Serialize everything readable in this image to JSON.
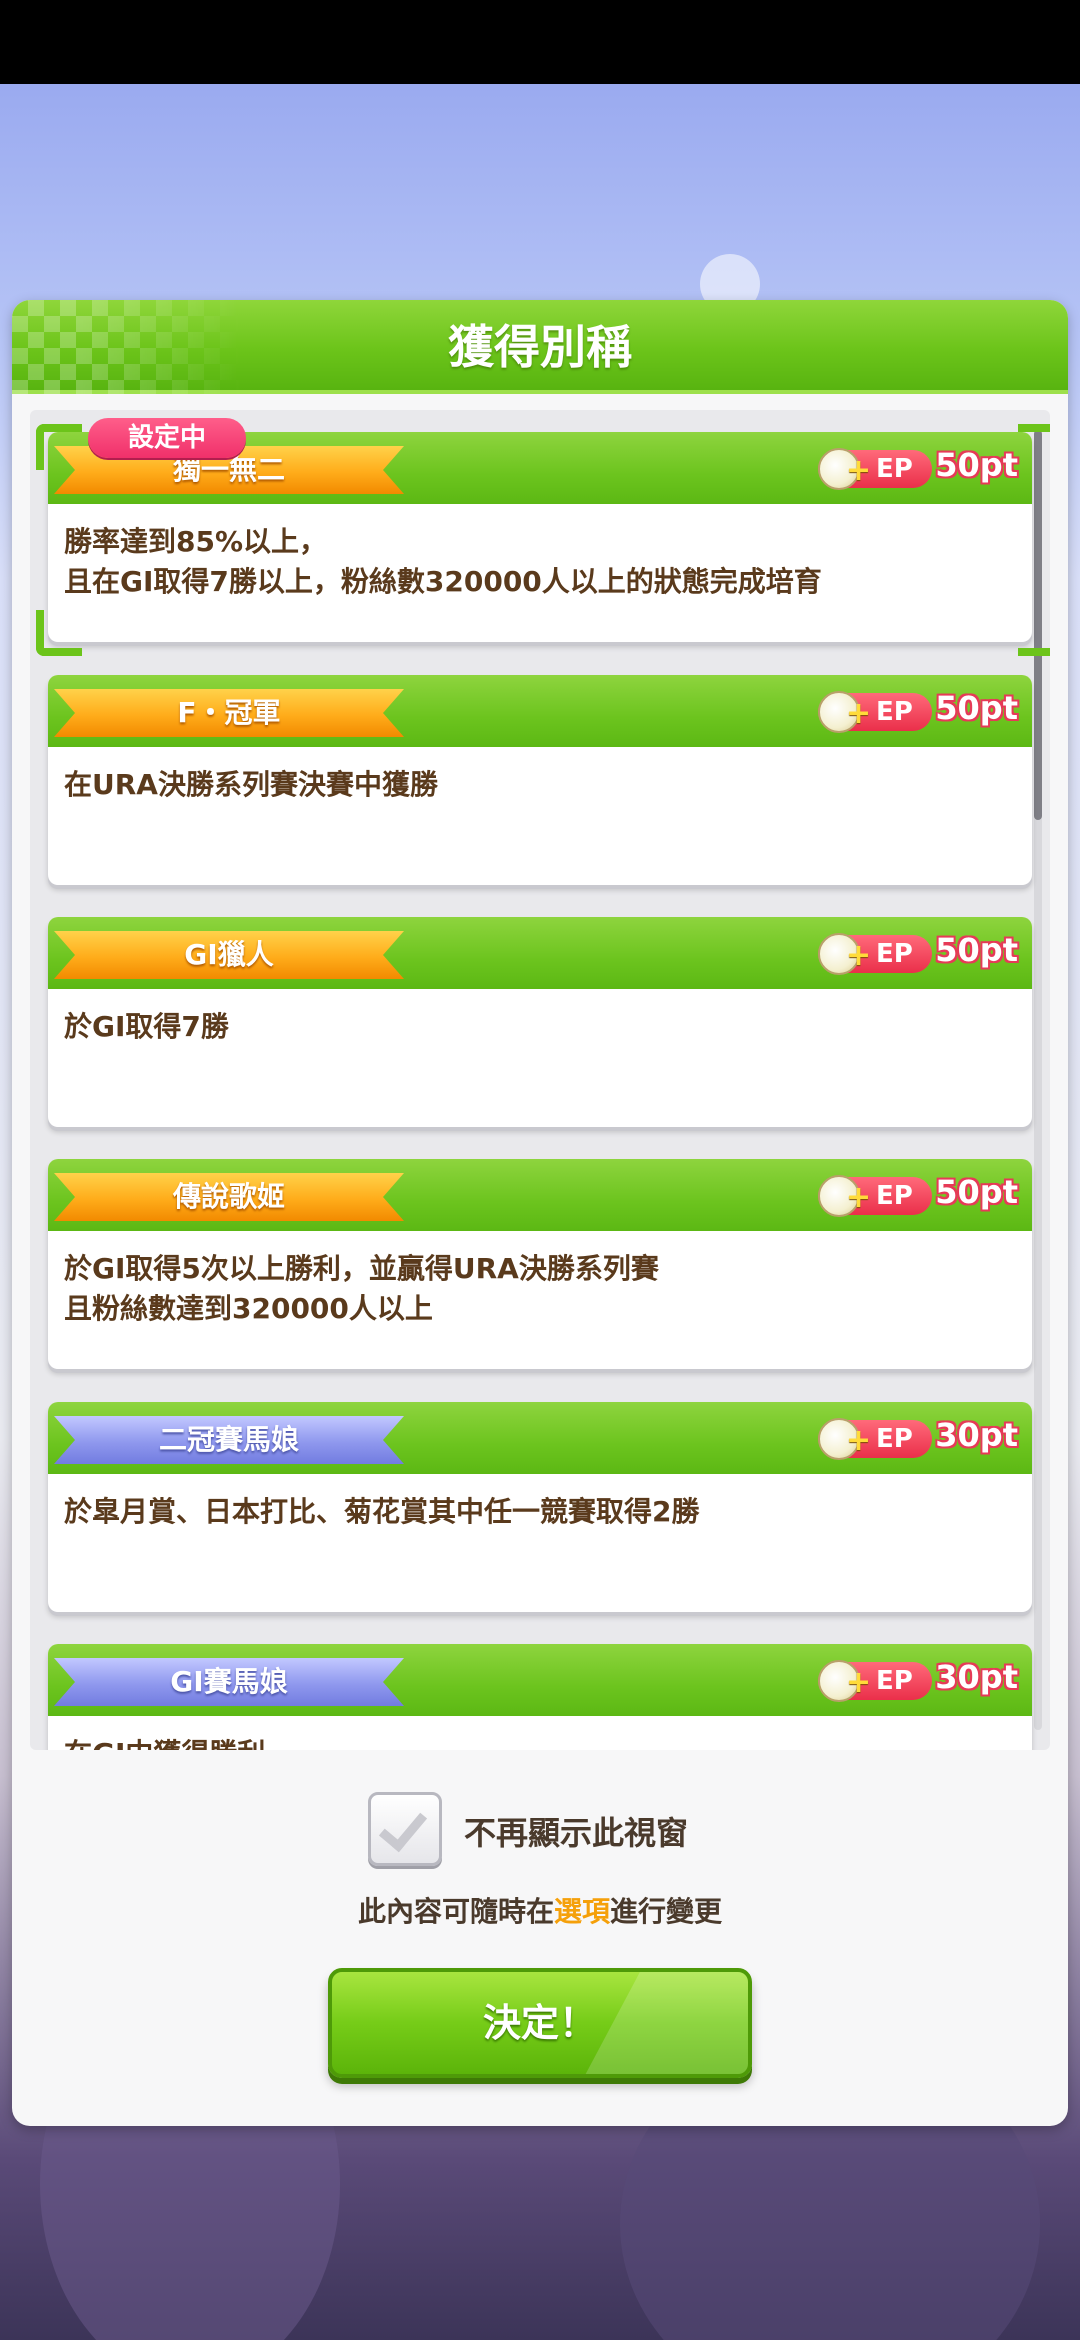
{
  "dialog": {
    "title": "獲得別稱"
  },
  "titles": [
    {
      "name": "獨一無二",
      "badge": "設定中",
      "ep_label": "EP",
      "points": "50pt",
      "description": "勝率達到85%以上，\n且在GⅠ取得7勝以上，粉絲數320000人以上的狀態完成培育",
      "ribbon_color": "#f28a00"
    },
    {
      "name": "F・冠軍",
      "ep_label": "EP",
      "points": "50pt",
      "description": "在URA決勝系列賽決賽中獲勝",
      "ribbon_color": "#f28a00"
    },
    {
      "name": "GⅠ獵人",
      "ep_label": "EP",
      "points": "50pt",
      "description": "於GⅠ取得7勝",
      "ribbon_color": "#f28a00"
    },
    {
      "name": "傳說歌姬",
      "ep_label": "EP",
      "points": "50pt",
      "description": "於GⅠ取得5次以上勝利，並贏得URA決勝系列賽\n且粉絲數達到320000人以上",
      "ribbon_color": "#f28a00"
    },
    {
      "name": "二冠賽馬娘",
      "ep_label": "EP",
      "points": "30pt",
      "description": "於皐月賞、日本打比、菊花賞其中任一競賽取得2勝",
      "ribbon_color": "#727ce0"
    },
    {
      "name": "GⅠ賽馬娘",
      "ep_label": "EP",
      "points": "30pt",
      "description": "在GⅠ中獲得勝利",
      "ribbon_color": "#727ce0"
    }
  ],
  "footer": {
    "checkbox_label": "不再顯示此視窗",
    "checkbox_checked": false,
    "note_prefix": "此內容可隨時在",
    "note_highlight": "選項",
    "note_suffix": "進行變更",
    "confirm_label": "決定！"
  },
  "colors": {
    "header_green": "#6cc41a",
    "ep_red": "#ea2f4a",
    "highlight_orange": "#f5a00a",
    "text_brown": "#5a3a1c"
  }
}
